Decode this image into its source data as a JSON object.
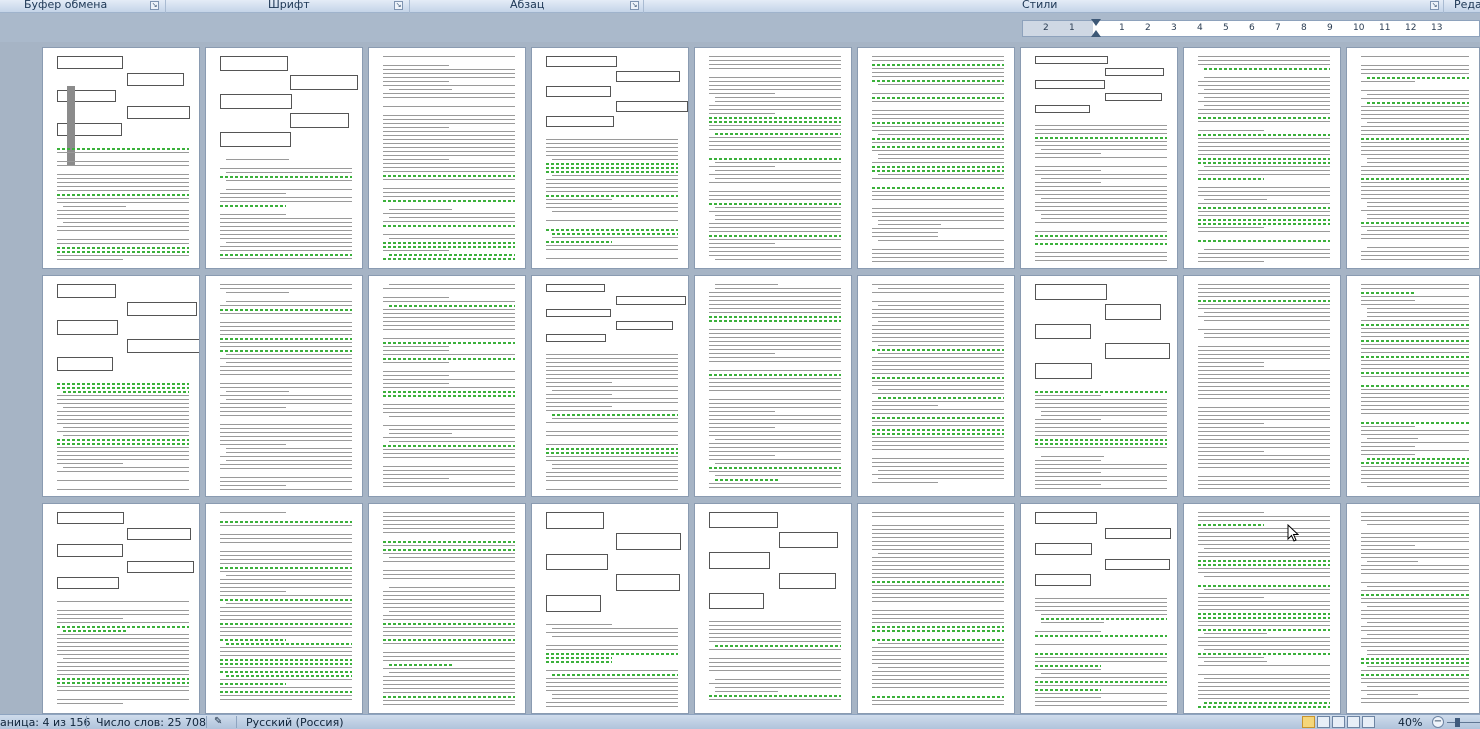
{
  "ribbon": {
    "groups": [
      {
        "label": "Буфер обмена"
      },
      {
        "label": "Шрифт"
      },
      {
        "label": "Абзац"
      },
      {
        "label": "Стили"
      },
      {
        "label": "Реда"
      }
    ]
  },
  "ruler": {
    "ticks": [
      "2",
      "1",
      "1",
      "2",
      "3",
      "4",
      "5",
      "6",
      "7",
      "8",
      "9",
      "10",
      "11",
      "12",
      "13"
    ]
  },
  "status": {
    "page": "аница: 4 из 156",
    "words": "Число слов: 25 708",
    "language": "Русский (Россия)",
    "zoom": "40%"
  },
  "icons": {
    "dialog_launcher": "dialog-launcher-icon",
    "cursor": "mouse-pointer-icon",
    "spellcheck": "spellcheck-icon",
    "view_print": "print-layout-icon",
    "view_full": "full-screen-reading-icon",
    "view_web": "web-layout-icon",
    "view_outline": "outline-icon",
    "view_draft": "draft-icon"
  },
  "colors": {
    "workspace": "#a6b4c5",
    "spell_underline": "#3bb03b",
    "page": "#ffffff"
  }
}
